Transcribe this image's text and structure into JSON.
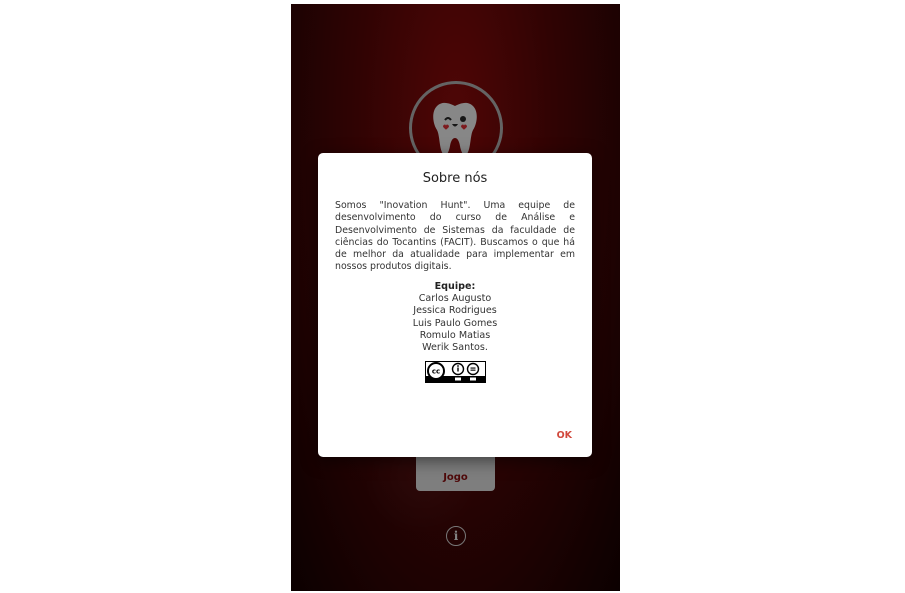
{
  "app": {
    "game_button_label": "Jogo",
    "info_icon": "info-icon"
  },
  "dialog": {
    "title": "Sobre nós",
    "body": "Somos \"Inovation Hunt\". Uma equipe de desenvolvimento do curso de Análise e Desenvolvimento de Sistemas da faculdade de ciências do Tocantins (FACIT). Buscamos o que há de melhor da atualidade para implementar em nossos produtos digitais.",
    "team_heading": "Equipe:",
    "team_members": [
      "Carlos Augusto",
      "Jessica Rodrigues",
      "Luis Paulo Gomes",
      "Romulo Matias",
      "Werik Santos."
    ],
    "license_badge": "cc-by-nd-badge",
    "ok_label": "OK"
  },
  "colors": {
    "background_red": "#4d0606",
    "accent": "#d1483c",
    "game_label": "#7a0f10"
  }
}
